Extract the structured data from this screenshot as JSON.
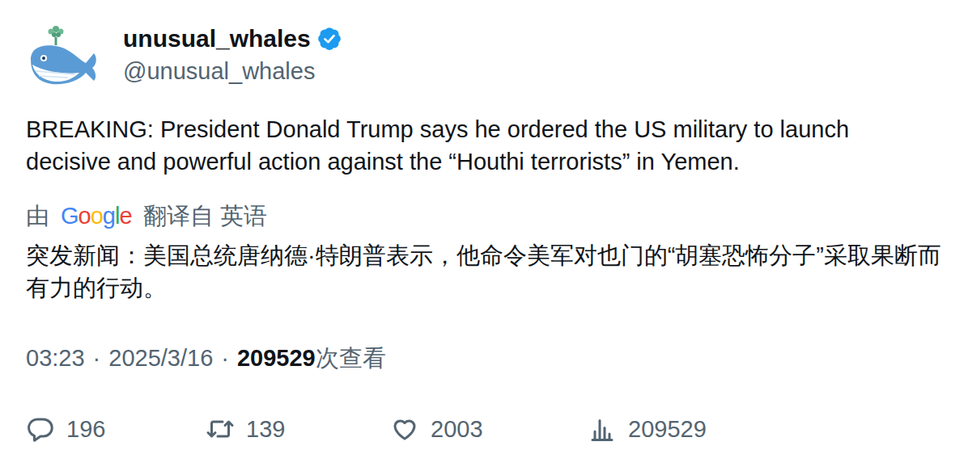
{
  "author": {
    "name": "unusual_whales",
    "handle": "@unusual_whales",
    "verified": true
  },
  "tweet": {
    "text": "BREAKING: President Donald Trump says he ordered the US military to launch decisive and powerful action against the “Houthi terrorists” in Yemen."
  },
  "translation": {
    "prefix": "由",
    "brand": "Google",
    "suffix": "翻译自 英语",
    "text": "突发新闻：美国总统唐纳德·特朗普表示，他命令美军对也门的“胡塞恐怖分子”采取果断而有力的行动。"
  },
  "meta": {
    "time": "03:23",
    "separator": "·",
    "date": "2025/3/16",
    "views": "209529",
    "views_label": "次查看"
  },
  "actions": [
    {
      "kind": "reply",
      "count": "196"
    },
    {
      "kind": "retweet",
      "count": "139"
    },
    {
      "kind": "like",
      "count": "2003"
    },
    {
      "kind": "views",
      "count": "209529"
    }
  ]
}
